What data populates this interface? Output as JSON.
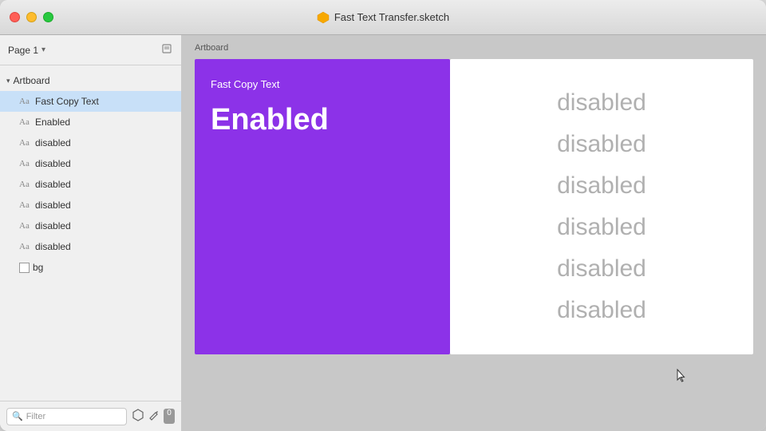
{
  "window": {
    "title": "Fast Text Transfer.sketch",
    "traffic_lights": {
      "close_label": "close",
      "minimize_label": "minimize",
      "maximize_label": "maximize"
    }
  },
  "sidebar": {
    "page_selector": {
      "label": "Page 1",
      "arrow": "▾"
    },
    "artboard_group": {
      "label": "Artboard",
      "arrow": "▾"
    },
    "layers": [
      {
        "icon": "Aa",
        "label": "Fast Copy Text",
        "selected": true
      },
      {
        "icon": "Aa",
        "label": "Enabled"
      },
      {
        "icon": "Aa",
        "label": "disabled"
      },
      {
        "icon": "Aa",
        "label": "disabled"
      },
      {
        "icon": "Aa",
        "label": "disabled"
      },
      {
        "icon": "Aa",
        "label": "disabled"
      },
      {
        "icon": "Aa",
        "label": "disabled"
      },
      {
        "icon": "Aa",
        "label": "disabled"
      },
      {
        "icon": "rect",
        "label": "bg"
      }
    ],
    "footer": {
      "filter_placeholder": "Filter",
      "filter_icon": "🔍",
      "symbol_icon": "⬡",
      "badge": "0"
    }
  },
  "canvas": {
    "artboard_label": "Artboard",
    "left_panel": {
      "subtitle": "Fast Copy Text",
      "title": "Enabled",
      "background_color": "#8c32e8"
    },
    "right_panel": {
      "items": [
        "disabled",
        "disabled",
        "disabled",
        "disabled",
        "disabled",
        "disabled"
      ]
    }
  }
}
